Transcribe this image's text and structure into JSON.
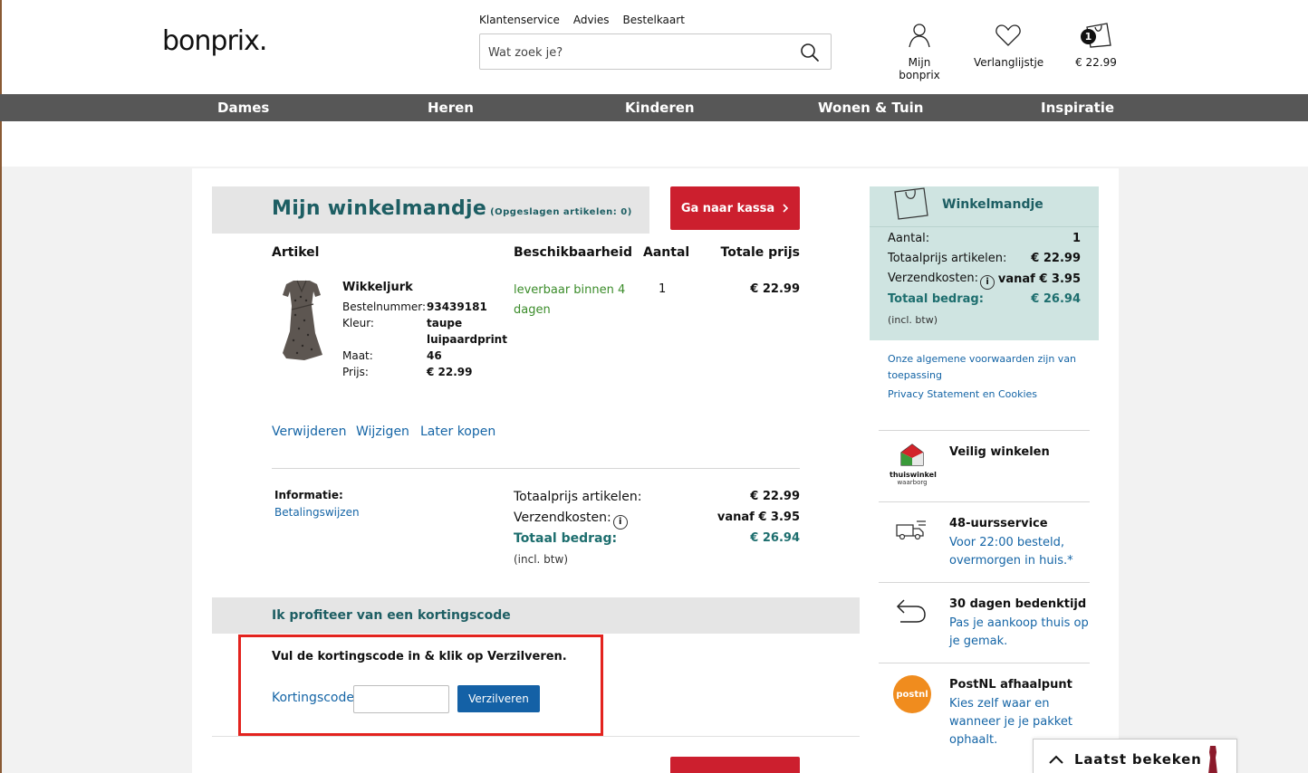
{
  "header": {
    "logo": "bonprix.",
    "top_links": [
      "Klantenservice",
      "Advies",
      "Bestelkaart"
    ],
    "search_placeholder": "Wat zoek je?",
    "account_label": "Mijn bonprix",
    "wishlist_label": "Verlanglijstje",
    "cart_badge": "1",
    "cart_total": "€ 22.99"
  },
  "nav": {
    "items": [
      "Dames",
      "Heren",
      "Kinderen",
      "Wonen & Tuin",
      "Inspiratie"
    ]
  },
  "cart": {
    "title": "Mijn winkelmandje",
    "saved_note": "(Opgeslagen artikelen: 0)",
    "checkout_label": "Ga naar kassa",
    "columns": [
      "Artikel",
      "Beschikbaarheid",
      "Aantal",
      "Totale prijs"
    ],
    "item": {
      "name": "Wikkeljurk",
      "order_number_label": "Bestelnummer:",
      "order_number": "93439181",
      "color_label": "Kleur:",
      "color_line1": "taupe",
      "color_line2": "luipaardprint",
      "size_label": "Maat:",
      "size": "46",
      "price_label": "Prijs:",
      "price": "€ 22.99",
      "availability": "leverbaar binnen 4 dagen",
      "quantity": "1",
      "total": "€ 22.99",
      "actions": [
        "Verwijderen",
        "Wijzigen",
        "Later kopen"
      ]
    },
    "info_label": "Informatie:",
    "payment_link": "Betalingswijzen",
    "summary": {
      "items_total_label": "Totaalprijs artikelen:",
      "items_total": "€ 22.99",
      "shipping_label": "Verzendkosten:",
      "shipping": "vanaf € 3.95",
      "grand_total_label": "Totaal bedrag:",
      "grand_total": "€ 26.94",
      "vat_note": "(incl. btw)"
    }
  },
  "discount": {
    "title": "Ik profiteer van een kortingscode",
    "instruction": "Vul de kortingscode in & klik op Verzilveren.",
    "code_label": "Kortingscode:",
    "code_value": "",
    "redeem_label": "Verzilveren"
  },
  "sidebar": {
    "title": "Winkelmandje",
    "quantity_label": "Aantal:",
    "quantity": "1",
    "items_total_label": "Totaalprijs artikelen:",
    "items_total": "€ 22.99",
    "shipping_label": "Verzendkosten:",
    "shipping": "vanaf € 3.95",
    "grand_total_label": "Totaal bedrag:",
    "grand_total": "€ 26.94",
    "vat_note": "(incl. btw)",
    "terms_link": "Onze algemene voorwaarden zijn van toepassing",
    "privacy_link": "Privacy Statement en Cookies",
    "usps": [
      {
        "title": "Veilig winkelen",
        "text": "",
        "icon": "thuiswinkel-logo-icon",
        "logo_line1": "thuiswinkel",
        "logo_line2": "waarborg"
      },
      {
        "title": "48-uursservice",
        "text": "Voor 22:00 besteld, overmorgen in huis.*",
        "icon": "truck-icon"
      },
      {
        "title": "30 dagen bedenktijd",
        "text": "Pas je aankoop thuis op je gemak.",
        "icon": "return-arrow-icon"
      },
      {
        "title": "PostNL afhaalpunt",
        "text": "Kies zelf waar en wanneer je je pakket ophaalt.",
        "icon": "postnl-logo-icon",
        "logo_text": "postnl"
      }
    ]
  },
  "recently_viewed": {
    "label": "Laatst bekeken"
  },
  "colors": {
    "teal": "#1d5e63",
    "red": "#cc1f2e",
    "link_blue": "#1565a6",
    "green": "#3b8c2a",
    "nav_grey": "#575757",
    "sidebar_bg": "#cfe4e1"
  }
}
